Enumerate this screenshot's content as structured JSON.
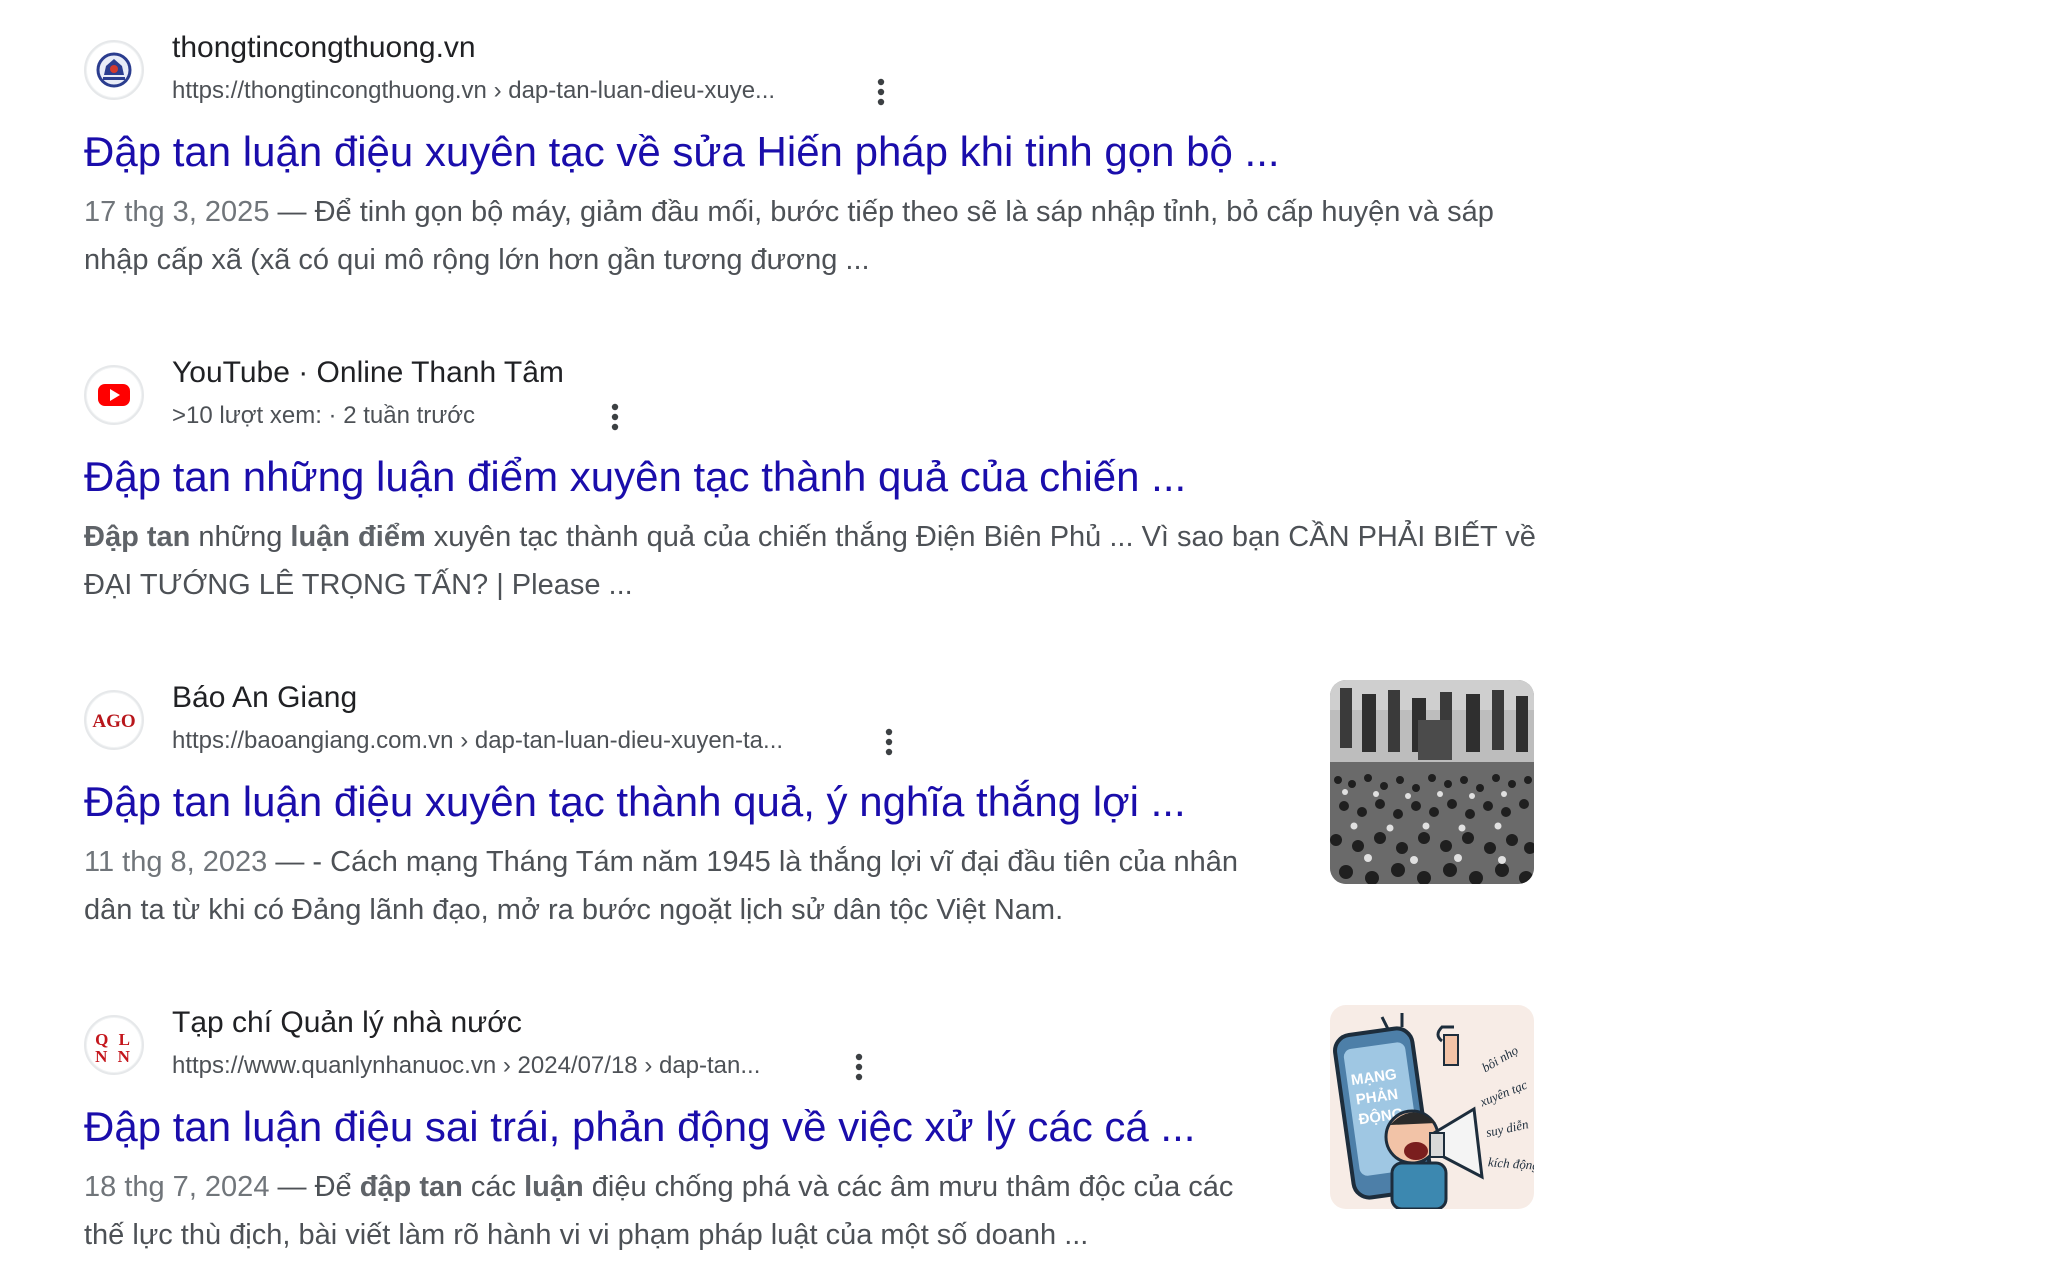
{
  "results": [
    {
      "favicon": "site-emblem-icon",
      "site": "thongtincongthuong.vn",
      "url": "https://thongtincongthuong.vn › dap-tan-luan-dieu-xuye...",
      "title": "Đập tan luận điệu xuyên tạc về sửa Hiến pháp khi tinh gọn bộ ...",
      "date": "17 thg 3, 2025",
      "separator": " — ",
      "snippet": "Để tinh gọn bộ máy, giảm đầu mối, bước tiếp theo sẽ là sáp nhập tỉnh, bỏ cấp huyện và sáp nhập cấp xã (xã có qui mô rộng lớn hơn gần tương đương ..."
    },
    {
      "favicon": "youtube-icon",
      "site": "YouTube · Online Thanh Tâm",
      "meta": ">10 lượt xem: · 2 tuần trước",
      "title": "Đập tan những luận điểm xuyên tạc thành quả của chiến ...",
      "snippet_parts": [
        {
          "text": "Đập tan",
          "bold": true
        },
        {
          "text": " những ",
          "bold": false
        },
        {
          "text": "luận điểm",
          "bold": true
        },
        {
          "text": " xuyên tạc thành quả của chiến thắng Điện Biên Phủ ... Vì sao bạn CẦN PHẢI BIẾT về ĐẠI TƯỚNG LÊ TRỌNG TẤN? | Please ...",
          "bold": false
        }
      ]
    },
    {
      "favicon": "ago-logo-icon",
      "favicon_text": "AGO",
      "site": "Báo An Giang",
      "url": "https://baoangiang.com.vn › dap-tan-luan-dieu-xuyen-ta...",
      "title": "Đập tan luận điệu xuyên tạc thành quả, ý nghĩa thắng lợi ...",
      "date": "11 thg 8, 2023",
      "separator": " — ",
      "snippet": "- Cách mạng Tháng Tám năm 1945 là thắng lợi vĩ đại đầu tiên của nhân dân ta từ khi có Đảng lãnh đạo, mở ra bước ngoặt lịch sử dân tộc Việt Nam.",
      "thumbnail": "historic-crowd-photo"
    },
    {
      "favicon": "qlnn-logo-icon",
      "favicon_text": "QLNN",
      "site": "Tạp chí Quản lý nhà nước",
      "url": "https://www.quanlynhanuoc.vn › 2024/07/18 › dap-tan...",
      "title": "Đập tan luận điệu sai trái, phản động về việc xử lý các cá ...",
      "date": "18 thg 7, 2024",
      "separator": " — ",
      "snippet_parts": [
        {
          "text": "Để ",
          "bold": false
        },
        {
          "text": "đập tan",
          "bold": true
        },
        {
          "text": " các ",
          "bold": false
        },
        {
          "text": "luận",
          "bold": true
        },
        {
          "text": " điệu chống phá và các âm mưu thâm độc của các thế lực thù địch, bài viết làm rõ hành vi vi phạm pháp luật của một số doanh ...",
          "bold": false
        }
      ],
      "thumbnail": "propaganda-cartoon-illustration",
      "thumb_text": [
        "MẠNG",
        "PHẢN",
        "ĐỘNG",
        "bôi nhọ",
        "xuyên tạc",
        "suy diễn",
        "kích động"
      ]
    }
  ],
  "colors": {
    "link": "#1a0dab",
    "text": "#202124",
    "muted": "#4d5156",
    "date": "#70757a"
  }
}
